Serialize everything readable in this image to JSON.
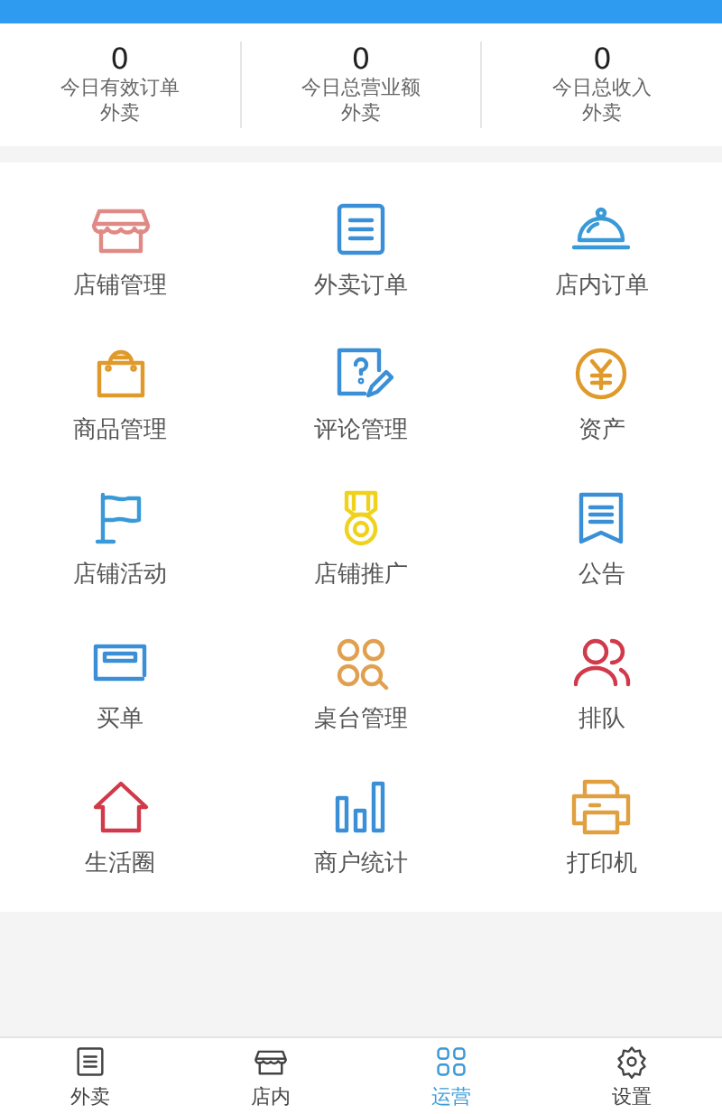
{
  "stats": [
    {
      "value": "0",
      "label": "今日有效订单",
      "sub": "外卖"
    },
    {
      "value": "0",
      "label": "今日总营业额",
      "sub": "外卖"
    },
    {
      "value": "0",
      "label": "今日总收入",
      "sub": "外卖"
    }
  ],
  "grid": [
    {
      "label": "店铺管理",
      "kind": "shop",
      "color": "#e08a86"
    },
    {
      "label": "外卖订单",
      "kind": "list",
      "color": "#3a8fd6"
    },
    {
      "label": "店内订单",
      "kind": "cloche",
      "color": "#3a9ad8"
    },
    {
      "label": "商品管理",
      "kind": "bag",
      "color": "#e09a2c"
    },
    {
      "label": "评论管理",
      "kind": "comment",
      "color": "#3a8fd6"
    },
    {
      "label": "资产",
      "kind": "yen",
      "color": "#e09a2c"
    },
    {
      "label": "店铺活动",
      "kind": "flag",
      "color": "#3a9ad8"
    },
    {
      "label": "店铺推广",
      "kind": "medal",
      "color": "#f0d21e"
    },
    {
      "label": "公告",
      "kind": "notice",
      "color": "#3a8fd6"
    },
    {
      "label": "买单",
      "kind": "card",
      "color": "#3a8fd6"
    },
    {
      "label": "桌台管理",
      "kind": "tables",
      "color": "#e0a050"
    },
    {
      "label": "排队",
      "kind": "people",
      "color": "#d03a4a"
    },
    {
      "label": "生活圈",
      "kind": "house",
      "color": "#d03a4a"
    },
    {
      "label": "商户统计",
      "kind": "bars",
      "color": "#3a8fd6"
    },
    {
      "label": "打印机",
      "kind": "printer",
      "color": "#e0a040"
    }
  ],
  "tabs": [
    {
      "label": "外卖",
      "kind": "list",
      "selected": false
    },
    {
      "label": "店内",
      "kind": "shop",
      "selected": false
    },
    {
      "label": "运营",
      "kind": "grid",
      "selected": true
    },
    {
      "label": "设置",
      "kind": "gear",
      "selected": false
    }
  ]
}
